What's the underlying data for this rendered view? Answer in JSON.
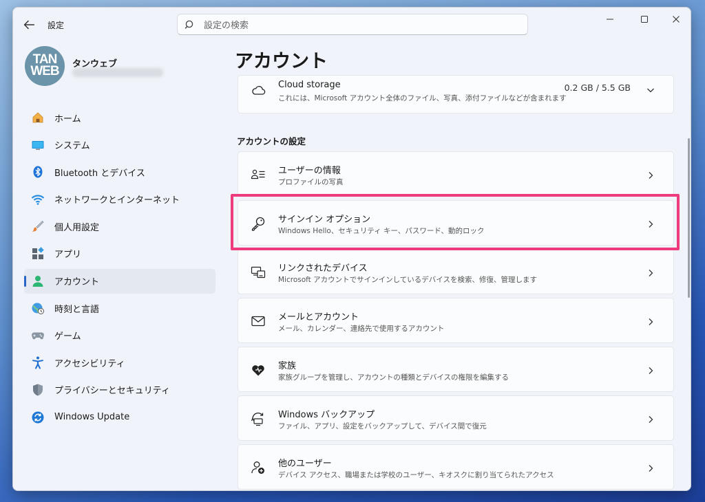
{
  "titlebar": {
    "app_title": "設定",
    "search_placeholder": "設定の検索"
  },
  "user": {
    "avatar_line1": "TAN",
    "avatar_line2": "WEB",
    "name": "タンウェブ"
  },
  "sidebar": {
    "items": [
      {
        "label": "ホーム",
        "icon": "home-icon"
      },
      {
        "label": "システム",
        "icon": "system-icon"
      },
      {
        "label": "Bluetooth とデバイス",
        "icon": "bluetooth-icon"
      },
      {
        "label": "ネットワークとインターネット",
        "icon": "network-icon"
      },
      {
        "label": "個人用設定",
        "icon": "brush-icon"
      },
      {
        "label": "アプリ",
        "icon": "apps-icon"
      },
      {
        "label": "アカウント",
        "icon": "account-icon",
        "active": true
      },
      {
        "label": "時刻と言語",
        "icon": "globe-clock-icon"
      },
      {
        "label": "ゲーム",
        "icon": "gamepad-icon"
      },
      {
        "label": "アクセシビリティ",
        "icon": "accessibility-icon"
      },
      {
        "label": "プライバシーとセキュリティ",
        "icon": "shield-icon"
      },
      {
        "label": "Windows Update",
        "icon": "update-icon"
      }
    ]
  },
  "main": {
    "page_title": "アカウント",
    "storage": {
      "title": "Cloud storage",
      "subtitle": "これには、Microsoft アカウント全体のファイル、写真、添付ファイルなどが含まれます",
      "value": "0.2 GB / 5.5 GB"
    },
    "section_title": "アカウントの設定",
    "settings": [
      {
        "title": "ユーザーの情報",
        "subtitle": "プロファイルの写真",
        "icon": "user-info-icon"
      },
      {
        "title": "サインイン オプション",
        "subtitle": "Windows Hello、セキュリティ キー、パスワード、動的ロック",
        "icon": "key-icon"
      },
      {
        "title": "リンクされたデバイス",
        "subtitle": "Microsoft アカウントでサインインしているデバイスを検索、修復、管理します",
        "icon": "linked-devices-icon"
      },
      {
        "title": "メールとアカウント",
        "subtitle": "メール、カレンダー、連絡先で使用するアカウント",
        "icon": "mail-icon"
      },
      {
        "title": "家族",
        "subtitle": "家族グループを管理し、アカウントの種類とデバイスの権限を編集する",
        "icon": "family-heart-icon"
      },
      {
        "title": "Windows バックアップ",
        "subtitle": "ファイル、アプリ、設定をバックアップして、デバイス間で復元",
        "icon": "backup-icon"
      },
      {
        "title": "他のユーザー",
        "subtitle": "デバイス アクセス、職場または学校のユーザー、キオスクに割り当てられたアクセス",
        "icon": "add-user-icon"
      }
    ]
  },
  "colors": {
    "accent": "#2b64c8",
    "highlight": "#ed3b7d"
  }
}
